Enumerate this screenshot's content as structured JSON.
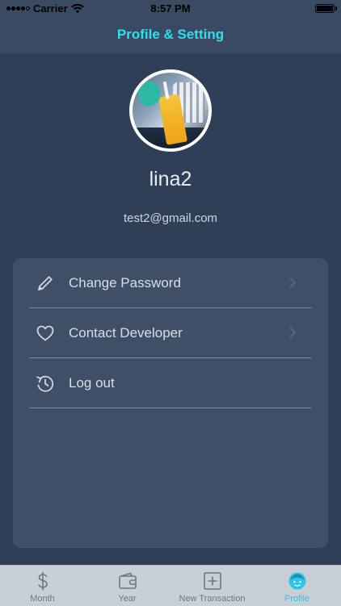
{
  "status_bar": {
    "carrier": "Carrier",
    "time": "8:57 PM"
  },
  "nav": {
    "title": "Profile & Setting"
  },
  "profile": {
    "username": "lina2",
    "email": "test2@gmail.com"
  },
  "menu": {
    "items": [
      {
        "label": "Change Password",
        "icon": "pencil-icon",
        "has_chevron": true
      },
      {
        "label": "Contact Developer",
        "icon": "heart-icon",
        "has_chevron": true
      },
      {
        "label": "Log out",
        "icon": "logout-icon",
        "has_chevron": false
      }
    ]
  },
  "tabbar": {
    "tabs": [
      {
        "label": "Month",
        "icon": "dollar-icon",
        "active": false
      },
      {
        "label": "Year",
        "icon": "wallet-icon",
        "active": false
      },
      {
        "label": "New Transaction",
        "icon": "add-square-icon",
        "active": false
      },
      {
        "label": "Profile",
        "icon": "face-icon",
        "active": true
      }
    ]
  },
  "colors": {
    "background": "#2e3f57",
    "nav_title": "#2ce0ee",
    "card": "#3e4f67",
    "tab_active": "#2cc4e8",
    "tab_inactive": "#6f7680"
  }
}
